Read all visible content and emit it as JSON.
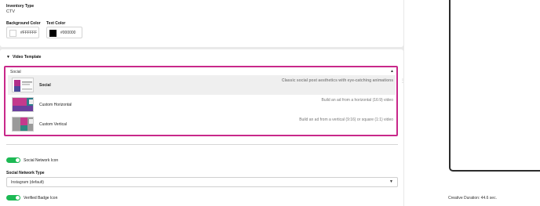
{
  "inventory": {
    "label": "Inventory Type",
    "value": "CTV"
  },
  "colors": {
    "background": {
      "label": "Background Color",
      "hex": "#FFFFFF"
    },
    "text": {
      "label": "Text Color",
      "hex": "#000000"
    }
  },
  "video_template": {
    "section_label": "Video Template",
    "selected": "Social",
    "options": [
      {
        "name": "Social",
        "description": "Classic social post aesthetics with eye-catching animations"
      },
      {
        "name": "Custom Horizontal",
        "description": "Build an ad from a horizontal (16:9) video"
      },
      {
        "name": "Custom Vertical",
        "description": "Build an ad from a vertical (9:16) or square (1:1) video"
      }
    ]
  },
  "social_network_icon": {
    "label": "Social Network Icon",
    "enabled": true
  },
  "social_network_type": {
    "label": "Social Network Type",
    "value": "Instagram (default)"
  },
  "verified_badge": {
    "label": "Verified Badge Icon",
    "enabled": true
  },
  "creative_duration": "Creative Duration: 44.6 sec.",
  "theme": {
    "accent": "#c8288a",
    "toggle_on": "#1db954"
  }
}
